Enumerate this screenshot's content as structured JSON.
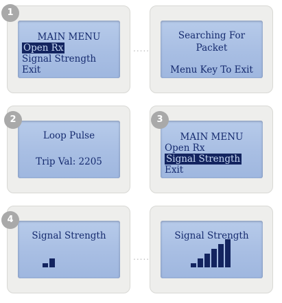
{
  "steps": [
    "1",
    "2",
    "3",
    "4"
  ],
  "panel1a": {
    "title": "MAIN MENU",
    "items": [
      "Open Rx",
      "Signal Strength",
      "Exit"
    ],
    "selected": 0
  },
  "panel1b": {
    "line1": "Searching For",
    "line2": "Packet",
    "line3": "Menu Key To Exit"
  },
  "panel2": {
    "line1": "Loop Pulse",
    "line2": "Trip Val: 2205"
  },
  "panel3": {
    "title": "MAIN MENU",
    "items": [
      "Open Rx",
      "Signal Strength",
      "Exit"
    ],
    "selected": 1
  },
  "panel4a": {
    "title": "Signal Strength",
    "level_bars": 2
  },
  "panel4b": {
    "title": "Signal Strength",
    "level_bars": 6
  },
  "connector": ".......",
  "colors": {
    "lcd": "#a8bee3",
    "lcd_text": "#152a6e",
    "badge": "#a9a9a9",
    "frame": "#eeeeec"
  }
}
